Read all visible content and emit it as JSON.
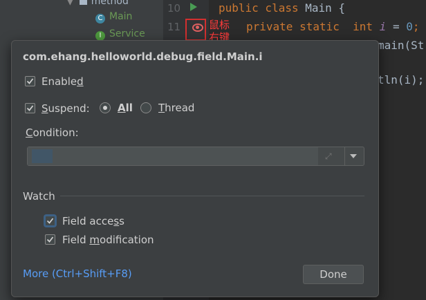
{
  "tree": {
    "folder_label": "method",
    "items": [
      {
        "label": "Main",
        "icon": "class-icon"
      },
      {
        "label": "Service",
        "icon": "interface-icon"
      }
    ]
  },
  "editor": {
    "line_numbers": [
      "10",
      "11"
    ],
    "line10": {
      "kw": "public class",
      "name": "Main",
      "brace": "{"
    },
    "line11": {
      "kw1": "private static",
      "kw2": "int",
      "var": "i",
      "eq": "=",
      "num": "0",
      "end": ";"
    },
    "line12_fragment": "main(St",
    "line13_fragment": "tln(i);",
    "annotation": "鼠标右键"
  },
  "dialog": {
    "title": "com.ehang.helloworld.debug.field.Main.i",
    "enabled": {
      "label_pre": "Enable",
      "label_u": "d",
      "label_post": "",
      "checked": true
    },
    "suspend": {
      "label_pre": "",
      "label_u": "S",
      "label_post": "uspend:",
      "checked": true
    },
    "suspend_all": {
      "label_pre": "",
      "label_u": "A",
      "label_post": "ll",
      "selected": true
    },
    "suspend_thread": {
      "label_pre": "",
      "label_u": "T",
      "label_post": "hread",
      "selected": false
    },
    "condition": {
      "label_pre": "",
      "label_u": "C",
      "label_post": "ondition:"
    },
    "watch_label": "Watch",
    "field_access": {
      "label_pre": "Field acce",
      "label_u": "s",
      "label_post": "s",
      "checked": true
    },
    "field_modification": {
      "label_pre": "Field ",
      "label_u": "m",
      "label_post": "odification",
      "checked": true
    },
    "more_link": "More (Ctrl+Shift+F8)",
    "done_button": "Done"
  }
}
